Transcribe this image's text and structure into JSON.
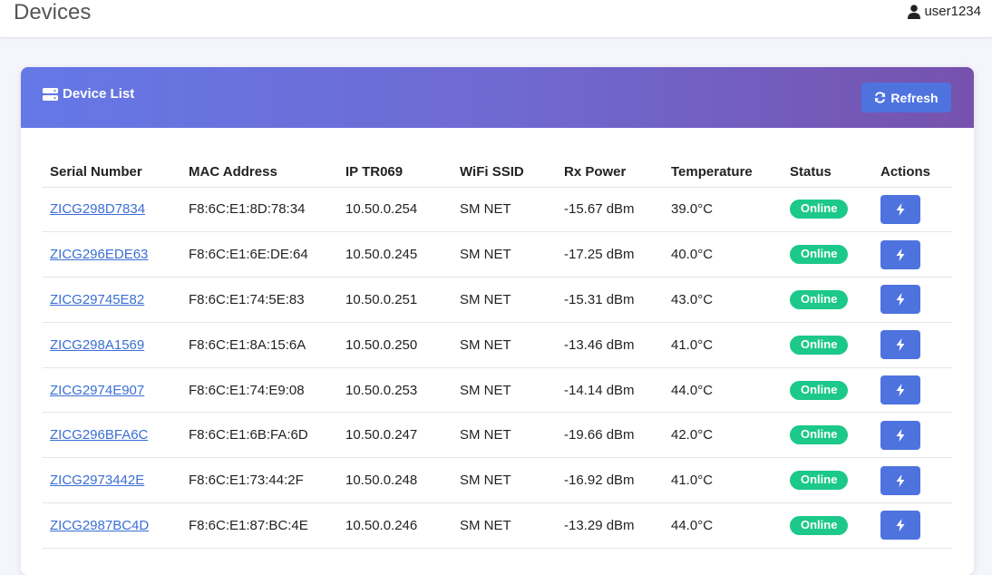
{
  "header": {
    "title": "Devices",
    "user": "user1234"
  },
  "card": {
    "title": "Device List",
    "refresh_label": "Refresh"
  },
  "table": {
    "columns": [
      "Serial Number",
      "MAC Address",
      "IP TR069",
      "WiFi SSID",
      "Rx Power",
      "Temperature",
      "Status",
      "Actions"
    ],
    "rows": [
      {
        "serial": "ZICG298D7834",
        "mac": "F8:6C:E1:8D:78:34",
        "ip": "10.50.0.254",
        "ssid": "SM NET",
        "rx": "-15.67 dBm",
        "temp": "39.0°C",
        "status": "Online"
      },
      {
        "serial": "ZICG296EDE63",
        "mac": "F8:6C:E1:6E:DE:64",
        "ip": "10.50.0.245",
        "ssid": "SM NET",
        "rx": "-17.25 dBm",
        "temp": "40.0°C",
        "status": "Online"
      },
      {
        "serial": "ZICG29745E82",
        "mac": "F8:6C:E1:74:5E:83",
        "ip": "10.50.0.251",
        "ssid": "SM NET",
        "rx": "-15.31 dBm",
        "temp": "43.0°C",
        "status": "Online"
      },
      {
        "serial": "ZICG298A1569",
        "mac": "F8:6C:E1:8A:15:6A",
        "ip": "10.50.0.250",
        "ssid": "SM NET",
        "rx": "-13.46 dBm",
        "temp": "41.0°C",
        "status": "Online"
      },
      {
        "serial": "ZICG2974E907",
        "mac": "F8:6C:E1:74:E9:08",
        "ip": "10.50.0.253",
        "ssid": "SM NET",
        "rx": "-14.14 dBm",
        "temp": "44.0°C",
        "status": "Online"
      },
      {
        "serial": "ZICG296BFA6C",
        "mac": "F8:6C:E1:6B:FA:6D",
        "ip": "10.50.0.247",
        "ssid": "SM NET",
        "rx": "-19.66 dBm",
        "temp": "42.0°C",
        "status": "Online"
      },
      {
        "serial": "ZICG2973442E",
        "mac": "F8:6C:E1:73:44:2F",
        "ip": "10.50.0.248",
        "ssid": "SM NET",
        "rx": "-16.92 dBm",
        "temp": "41.0°C",
        "status": "Online"
      },
      {
        "serial": "ZICG2987BC4D",
        "mac": "F8:6C:E1:87:BC:4E",
        "ip": "10.50.0.246",
        "ssid": "SM NET",
        "rx": "-13.29 dBm",
        "temp": "44.0°C",
        "status": "Online"
      }
    ]
  },
  "colors": {
    "accent": "#4e73df",
    "status_online": "#1cc88a",
    "header_gradient_start": "#6478e6",
    "header_gradient_end": "#7652ad"
  },
  "icons": {
    "user": "user-icon",
    "device_list": "server-icon",
    "refresh": "sync-icon",
    "action": "bolt-icon"
  }
}
